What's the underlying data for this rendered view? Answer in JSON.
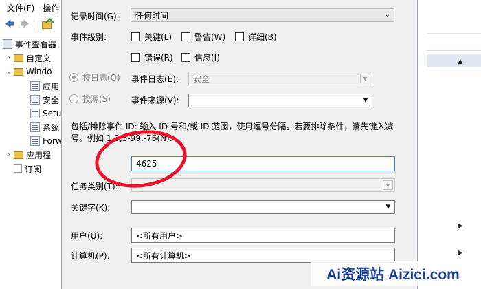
{
  "background_window": {
    "menu": [
      "文件(F)",
      "操作"
    ],
    "tree": [
      {
        "label": "事件查看器",
        "level": 0,
        "expander": ""
      },
      {
        "label": "自定义",
        "level": 1,
        "expander": "›"
      },
      {
        "label": "Windo",
        "level": 1,
        "expander": "⌄"
      },
      {
        "label": "应用",
        "level": 2,
        "expander": ""
      },
      {
        "label": "安全",
        "level": 2,
        "expander": ""
      },
      {
        "label": "Setu",
        "level": 2,
        "expander": ""
      },
      {
        "label": "系统",
        "level": 2,
        "expander": ""
      },
      {
        "label": "Forw",
        "level": 2,
        "expander": ""
      },
      {
        "label": "应用程",
        "level": 1,
        "expander": "›"
      },
      {
        "label": "订阅",
        "level": 1,
        "expander": ""
      }
    ]
  },
  "dialog": {
    "logged": {
      "label": "记录时间(G):",
      "value": "任何时间"
    },
    "event_level": {
      "label": "事件级别:",
      "options": [
        "关键(L)",
        "警告(W)",
        "详细(B)",
        "错误(R)",
        "信息(I)"
      ]
    },
    "by_log": {
      "label": "按日志(O)",
      "field_label": "事件日志(E):",
      "value": "安全"
    },
    "by_source": {
      "label": "按源(S)",
      "field_label": "事件来源(V):",
      "value": ""
    },
    "description": "包括/排除事件 ID: 输入 ID 号和/或 ID 范围，使用逗号分隔。若要排除条件，请先键入减号。例如 1,3,5-99,-76(N):",
    "event_id": {
      "value": "4625"
    },
    "task_category": {
      "label": "任务类别(T):",
      "value": ""
    },
    "keywords": {
      "label": "关键字(K):",
      "value": ""
    },
    "user": {
      "label": "用户(U):",
      "value": "<所有用户>"
    },
    "computer": {
      "label": "计算机(P):",
      "value": "<所有计算机>"
    }
  },
  "watermark": "Ai资源站 Aizici.com",
  "colors": {
    "annotation": "#e8132a",
    "watermark": "#1a3f96",
    "dialog_bg": "#f0f0f0"
  }
}
